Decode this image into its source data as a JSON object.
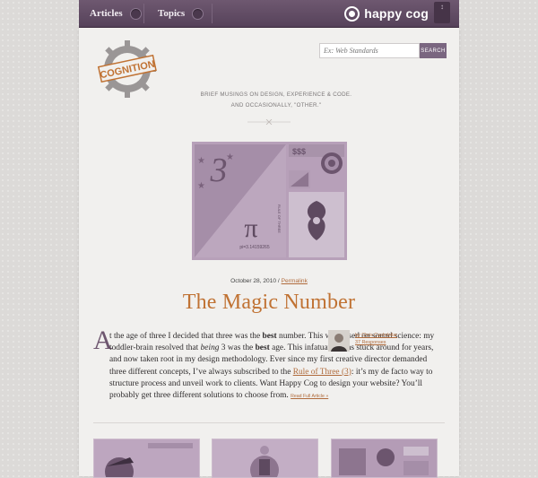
{
  "nav": {
    "items": [
      {
        "label": "Articles"
      },
      {
        "label": "Topics"
      }
    ],
    "brand": "happy cog",
    "tab_glyph": "↕"
  },
  "logo": {
    "text": "COGNITION"
  },
  "search": {
    "placeholder": "Ex: Web Standards",
    "button_label": "SEARCH"
  },
  "tagline": {
    "line1": "BRIEF MUSINGS ON DESIGN, EXPERIENCE & CODE.",
    "line2": "AND OCCASIONALLY, \"OTHER.\""
  },
  "hero": {
    "numeral": "3",
    "pi": "π",
    "pi_value": "pi=3.14159265",
    "dollars": "$$$",
    "vertical_label": "RULE OF THREE"
  },
  "post": {
    "date": "October 28, 2010",
    "permalink": "Permalink",
    "title": "The Magic Number",
    "dropcap": "A",
    "p_first": "t the age of three I decided that three was the ",
    "best": "best",
    "p_a": " number. This was based on sound science: my toddler-brain resolved that ",
    "being": "being",
    "p_b": " 3 was the ",
    "p_c": " age. This infatuation has stuck around for years, and now taken root in my design methodology. Ever since my first creative director demanded three different concepts, I’ve always subscribed to the ",
    "rule_link": "Rule of Three (3)",
    "p_d": ": it’s my de facto way to structure process and unveil work to clients. Want Happy Cog to design your website? You’ll probably get three different solutions to choose from.",
    "read_more": "Read Full Article »"
  },
  "author": {
    "by": "by Chris Cashdollar",
    "responses": "37 Responses"
  },
  "colors": {
    "nav": "#5f4a62",
    "accent": "#c07233",
    "hero": "#a58ea8"
  }
}
